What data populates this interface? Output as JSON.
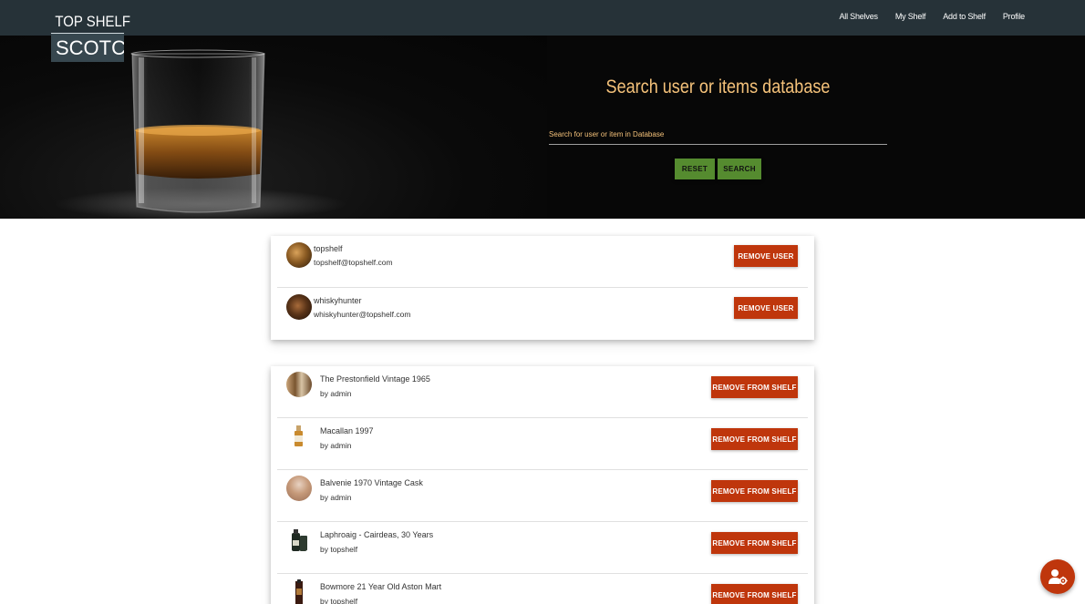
{
  "logo": {
    "line1": "TOP SHELF",
    "line2": "SCOTCH"
  },
  "nav": {
    "items": [
      "All Shelves",
      "My Shelf",
      "Add to Shelf",
      "Profile"
    ]
  },
  "hero": {
    "title": "Search user or items database",
    "search_placeholder": "Search for user or item in Database",
    "search_value": "",
    "reset_label": "RESET",
    "search_label": "SEARCH"
  },
  "users": [
    {
      "username": "topshelf",
      "email": "topshelf@topshelf.com",
      "action": "REMOVE USER"
    },
    {
      "username": "whiskyhunter",
      "email": "whiskyhunter@topshelf.com",
      "action": "REMOVE USER"
    }
  ],
  "items": [
    {
      "name": "The Prestonfield Vintage 1965",
      "owner": "by admin",
      "action": "REMOVE FROM SHELF"
    },
    {
      "name": "Macallan 1997",
      "owner": "by admin",
      "action": "REMOVE FROM SHELF"
    },
    {
      "name": "Balvenie 1970 Vintage Cask",
      "owner": "by admin",
      "action": "REMOVE FROM SHELF"
    },
    {
      "name": "Laphroaig - Cairdeas, 30 Years",
      "owner": "by topshelf",
      "action": "REMOVE FROM SHELF"
    },
    {
      "name": "Bowmore 21 Year Old Aston Mart",
      "owner": "by topshelf",
      "action": "REMOVE FROM SHELF"
    }
  ],
  "fab": {
    "icon": "user-cog-icon"
  },
  "colors": {
    "nav": "#263238",
    "accent_gold": "#f5c27a",
    "green": "#558b2f",
    "red": "#bf360c"
  }
}
